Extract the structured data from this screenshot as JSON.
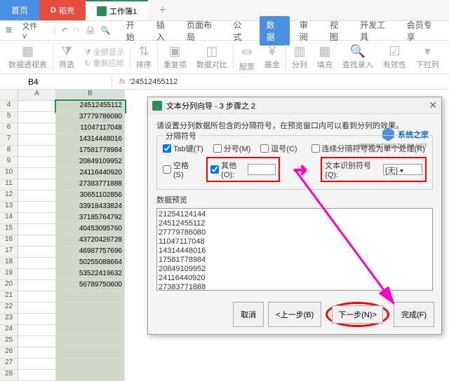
{
  "tabs": {
    "home": "首页",
    "shell": "稻壳",
    "workbook": "工作簿1"
  },
  "menu": {
    "file": "文件",
    "items": [
      "开始",
      "插入",
      "页面布局",
      "公式",
      "数据",
      "审阅",
      "视图",
      "开发工具",
      "会员专享"
    ]
  },
  "toolbar": {
    "pivot": "数据透视表",
    "filter": "筛选",
    "showall": "全部显示",
    "reapply": "重新应用",
    "sort": "排序",
    "dup": "重复项",
    "cmp": "数据对比",
    "stock": "股票",
    "fund": "基金",
    "split": "分列",
    "fill": "填充",
    "findin": "查找录入",
    "valid": "有效性",
    "dropdown": "下拉列"
  },
  "cell": {
    "ref": "B4",
    "fx": "fx",
    "val": "'24512455112"
  },
  "cols": [
    "A",
    "B"
  ],
  "rows": [
    "4",
    "5",
    "6",
    "7",
    "8",
    "9",
    "10",
    "11",
    "12",
    "13",
    "14",
    "15",
    "16",
    "17",
    "18",
    "19",
    "20",
    "21",
    "22",
    "23",
    "24",
    "25",
    "26",
    "27",
    "28"
  ],
  "data": [
    "24512455112",
    "37779786080",
    "11047117048",
    "14314448016",
    "17581778984",
    "20849109952",
    "24116440920",
    "27383771888",
    "30651102856",
    "33918433824",
    "37185764792",
    "40453095760",
    "43720426728",
    "46987757696",
    "50255088664",
    "53522419632",
    "56789750600"
  ],
  "dialog": {
    "title": "文本分列向导 - 3 步骤之 2",
    "desc": "请设置分列数据所包含的分隔符号，在预览窗口内可以看到分列的效果。",
    "grp_delim": "分隔符号",
    "tab": "Tab键(T)",
    "semicolon": "分号(M)",
    "comma": "逗号(C)",
    "space": "空格(S)",
    "other": "其他(O):",
    "consec": "连续分隔符号视为单个处理(R)",
    "textqual_lbl": "文本识别符号(Q):",
    "textqual_val": "{无}",
    "grp_preview": "数据预览",
    "preview_lines": [
      "21254124144",
      "24512455112",
      "27779786080",
      "11047117048",
      "14314448016",
      "17581778984",
      "20849109952",
      "24116440920",
      "27383771888"
    ],
    "btn_cancel": "取消",
    "btn_back": "<上一步(B)",
    "btn_next": "下一步(N)>",
    "btn_finish": "完成(F)"
  },
  "logo": {
    "text": "系统之家",
    "sub": "WWW.XITONGZHIJIA.NET"
  }
}
